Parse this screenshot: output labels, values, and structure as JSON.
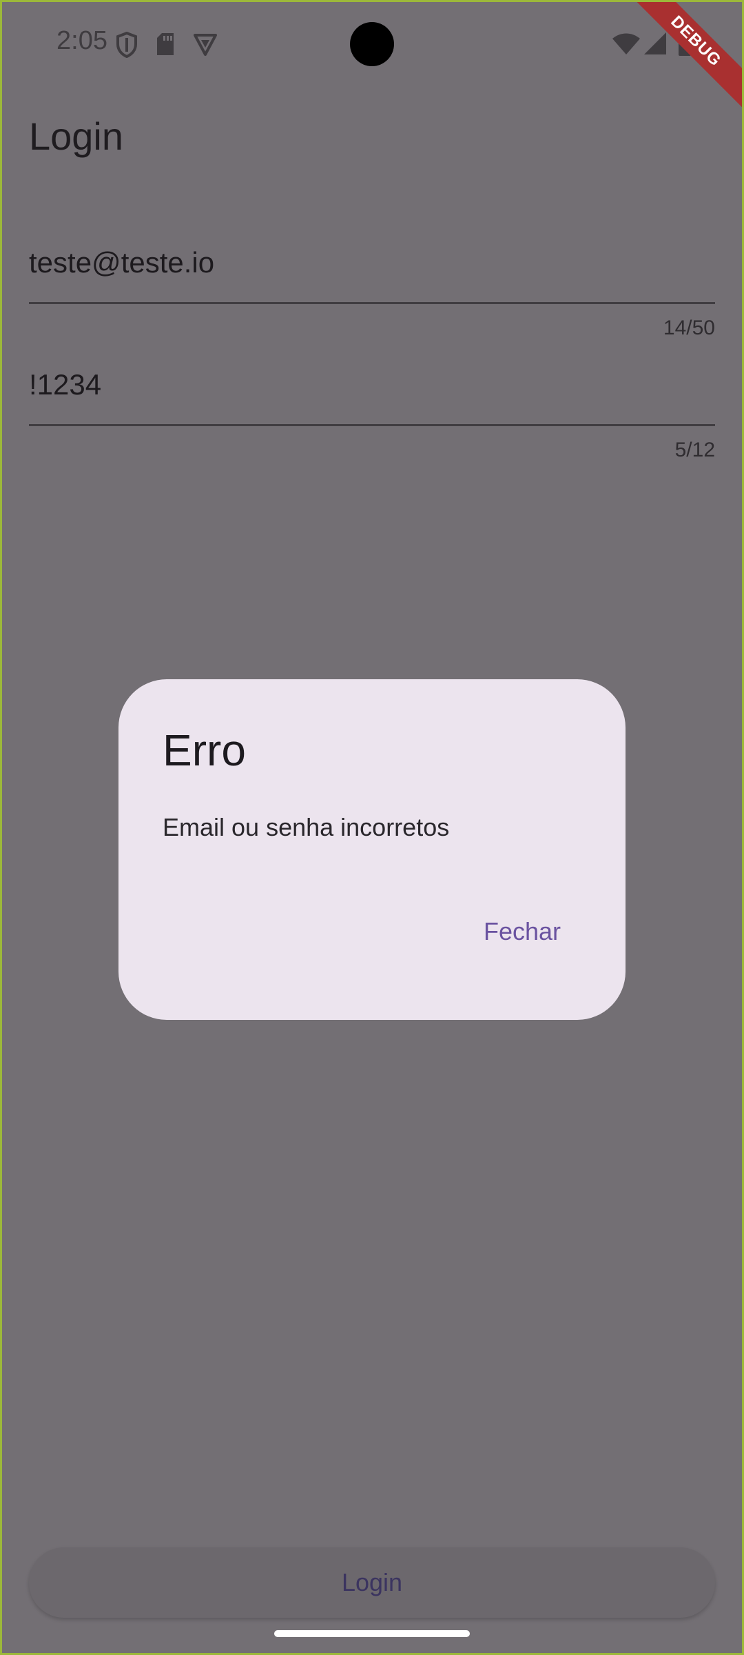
{
  "status_bar": {
    "time": "2:05",
    "icons_left": [
      "shield-icon",
      "sd-card-icon",
      "vpn-triangle-icon"
    ],
    "icons_right": [
      "wifi-icon",
      "cellular-signal-icon",
      "battery-icon"
    ]
  },
  "debug_banner": "DEBUG",
  "page": {
    "title": "Login"
  },
  "form": {
    "email": {
      "value": "teste@teste.io",
      "counter": "14/50"
    },
    "password": {
      "value": "!1234",
      "counter": "5/12"
    }
  },
  "login_button": {
    "label": "Login"
  },
  "dialog": {
    "title": "Erro",
    "message": "Email ou senha incorretos",
    "action_label": "Fechar"
  },
  "colors": {
    "scrim_background": "#736f74",
    "dialog_background": "#ece4ee",
    "accent": "#6a52a0",
    "frame_border": "#9cb83a",
    "debug_ribbon": "#a93030"
  }
}
